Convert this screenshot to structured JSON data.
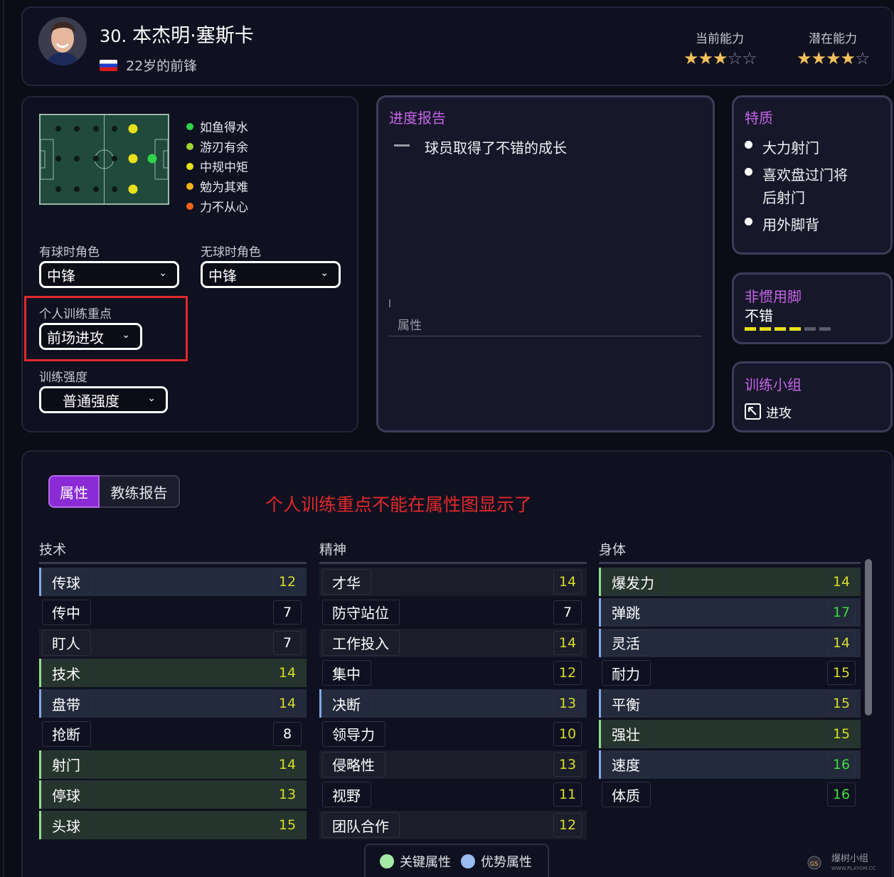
{
  "header": {
    "number": "30.",
    "name": "本杰明·塞斯卡",
    "subtitle": "22岁的前锋",
    "current_label": "当前能力",
    "potential_label": "潜在能力",
    "current_stars": 3,
    "potential_stars": 4,
    "max_stars": 5
  },
  "positions": {
    "legend": [
      {
        "label": "如鱼得水",
        "color": "#2fd34a"
      },
      {
        "label": "游刃有余",
        "color": "#9ed432"
      },
      {
        "label": "中规中矩",
        "color": "#e8e01a"
      },
      {
        "label": "勉为其难",
        "color": "#f0b21a"
      },
      {
        "label": "力不从心",
        "color": "#f0621a"
      }
    ]
  },
  "roles": {
    "in_possession_label": "有球时角色",
    "in_possession_value": "中锋",
    "out_possession_label": "无球时角色",
    "out_possession_value": "中锋",
    "focus_label": "个人训练重点",
    "focus_value": "前场进攻",
    "intensity_label": "训练强度",
    "intensity_value": "普通强度"
  },
  "progress": {
    "title": "进度报告",
    "text": "球员取得了不错的成长",
    "attr_label": "属性"
  },
  "traits": {
    "title": "特质",
    "items": [
      "大力射门",
      "喜欢盘过门将",
      "后射门",
      "用外脚背"
    ]
  },
  "weak_foot": {
    "title": "非惯用脚",
    "value": "不错",
    "level": 4,
    "max": 6
  },
  "training_group": {
    "title": "训练小组",
    "value": "进攻"
  },
  "tabs": {
    "attributes": "属性",
    "coach_report": "教练报告"
  },
  "annotation": "个人训练重点不能在属性图显示了",
  "columns": [
    {
      "title": "技术",
      "rows": [
        {
          "name": "传球",
          "value": "12",
          "mark": "blue"
        },
        {
          "name": "传中",
          "value": "7",
          "mark": ""
        },
        {
          "name": "盯人",
          "value": "7",
          "mark": ""
        },
        {
          "name": "技术",
          "value": "14",
          "mark": "green"
        },
        {
          "name": "盘带",
          "value": "14",
          "mark": "blue"
        },
        {
          "name": "抢断",
          "value": "8",
          "mark": ""
        },
        {
          "name": "射门",
          "value": "14",
          "mark": "green"
        },
        {
          "name": "停球",
          "value": "13",
          "mark": "green"
        },
        {
          "name": "头球",
          "value": "15",
          "mark": "green"
        }
      ]
    },
    {
      "title": "精神",
      "rows": [
        {
          "name": "才华",
          "value": "14",
          "mark": ""
        },
        {
          "name": "防守站位",
          "value": "7",
          "mark": ""
        },
        {
          "name": "工作投入",
          "value": "14",
          "mark": ""
        },
        {
          "name": "集中",
          "value": "12",
          "mark": ""
        },
        {
          "name": "决断",
          "value": "13",
          "mark": "blue"
        },
        {
          "name": "领导力",
          "value": "10",
          "mark": ""
        },
        {
          "name": "侵略性",
          "value": "13",
          "mark": ""
        },
        {
          "name": "视野",
          "value": "11",
          "mark": ""
        },
        {
          "name": "团队合作",
          "value": "12",
          "mark": ""
        }
      ]
    },
    {
      "title": "身体",
      "rows": [
        {
          "name": "爆发力",
          "value": "14",
          "mark": "green"
        },
        {
          "name": "弹跳",
          "value": "17",
          "mark": "blue"
        },
        {
          "name": "灵活",
          "value": "14",
          "mark": "blue"
        },
        {
          "name": "耐力",
          "value": "15",
          "mark": ""
        },
        {
          "name": "平衡",
          "value": "15",
          "mark": "blue"
        },
        {
          "name": "强壮",
          "value": "15",
          "mark": "green"
        },
        {
          "name": "速度",
          "value": "16",
          "mark": "blue"
        },
        {
          "name": "体质",
          "value": "16",
          "mark": ""
        }
      ]
    }
  ],
  "legend_box": {
    "key": "关键属性",
    "key_color": "#a6eaa8",
    "strong": "优势属性",
    "strong_color": "#9bbcf0"
  },
  "watermark": "爆树小组"
}
